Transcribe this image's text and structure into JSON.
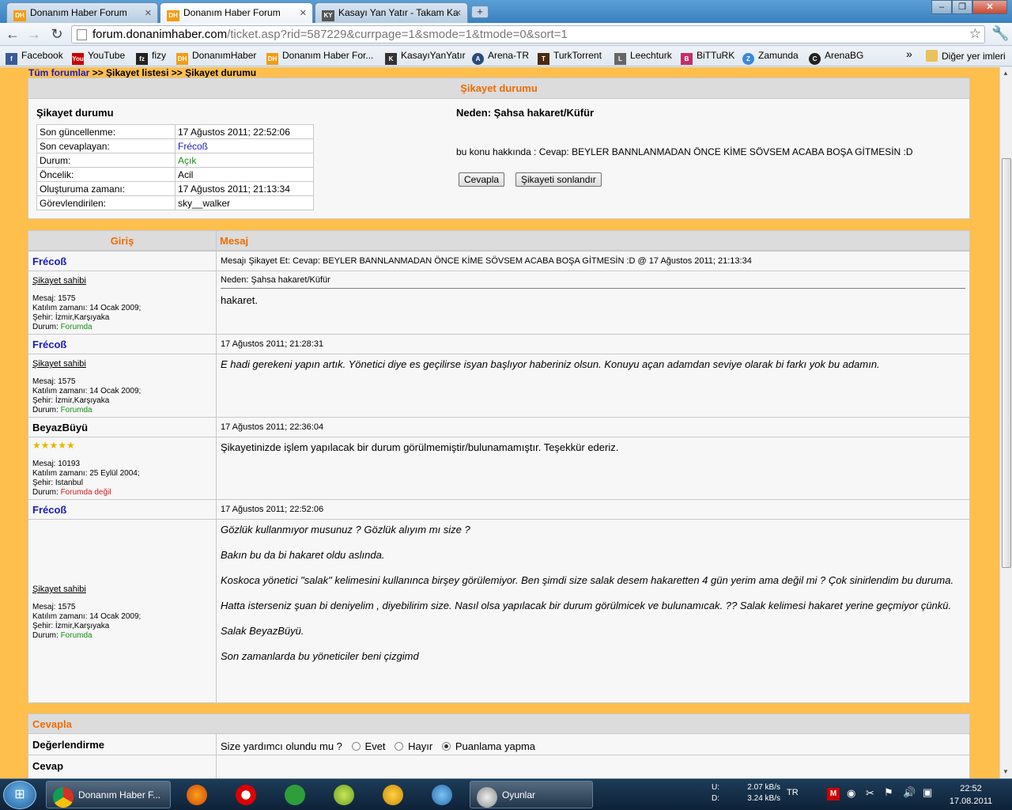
{
  "browser": {
    "tabs": [
      {
        "label": "Donanım Haber Forum",
        "icon": "DH",
        "active": false
      },
      {
        "label": "Donanım Haber Forum",
        "icon": "DH",
        "active": true
      },
      {
        "label": "Kasayı Yan Yatır - Takam Ka",
        "icon": "KY",
        "active": false
      }
    ],
    "url_host": "forum.donanimhaber.com",
    "url_path": "/ticket.asp?rid=587229&currpage=1&smode=1&tmode=0&sort=1"
  },
  "bookmarks": [
    {
      "label": "Facebook",
      "icon": "f",
      "color": "#3b5998"
    },
    {
      "label": "YouTube",
      "icon": "You",
      "color": "#cc0000"
    },
    {
      "label": "fizy",
      "icon": "fz",
      "color": "#222222"
    },
    {
      "label": "DonanımHaber",
      "icon": "DH",
      "color": "#f39c12"
    },
    {
      "label": "Donanım Haber For...",
      "icon": "DH",
      "color": "#f39c12"
    },
    {
      "label": "KasayıYanYatır",
      "icon": "K",
      "color": "#333333"
    },
    {
      "label": "Arena-TR",
      "icon": "A",
      "color": "#2a4a7a"
    },
    {
      "label": "TurkTorrent",
      "icon": "T",
      "color": "#4a2a10"
    },
    {
      "label": "Leechturk",
      "icon": "L",
      "color": "#666666"
    },
    {
      "label": "BiTTuRK",
      "icon": "B",
      "color": "#c0306a"
    },
    {
      "label": "Zamunda",
      "icon": "Z",
      "color": "#3a8ad8"
    },
    {
      "label": "ArenaBG",
      "icon": "C",
      "color": "#222222"
    }
  ],
  "bookmarks_other": "Diğer yer imleri",
  "breadcrumb": {
    "home": "Tüm forumlar",
    "list": ">> Şikayet listesi",
    "current": ">> Şikayet durumu"
  },
  "status_box": {
    "header": "Şikayet durumu",
    "title": "Şikayet durumu",
    "rows": [
      {
        "k": "Son güncellenme:",
        "v": "17 Ağustos 2011; 22:52:06"
      },
      {
        "k": "Son cevaplayan:",
        "v": "Frécoß"
      },
      {
        "k": "Durum:",
        "v": "Açık"
      },
      {
        "k": "Öncelik:",
        "v": "Acil"
      },
      {
        "k": "Oluşturuma zamanı:",
        "v": "17 Ağustos 2011; 21:13:34"
      },
      {
        "k": "Görevlendirilen:",
        "v": "sky__walker"
      }
    ],
    "reason": "Neden: Şahsa hakaret/Küfür",
    "about": "bu konu hakkında : Cevap: BEYLER BANNLANMADAN ÖNCE KİME SÖVSEM ACABA BOŞA GİTMESİN :D",
    "reply_button": "Cevapla",
    "close_button": "Şikayeti sonlandır"
  },
  "messages_table": {
    "col_user": "Giriş",
    "col_msg": "Mesaj",
    "posts": [
      {
        "user": "Frécoß",
        "time": "Mesajı Şikayet Et: Cevap: BEYLER BANNLANMADAN ÖNCE KİME SÖVSEM ACABA BOŞA GİTMESİN :D @ 17 Ağustos 2011; 21:13:34",
        "tag": "Şikayet sahibi",
        "stats": [
          "Mesaj: 1575",
          "Katılım zamanı: 14 Ocak 2009;",
          "Şehir: İzmir,Karşıyaka"
        ],
        "status_label": "Durum:",
        "status": "Forumda",
        "sub": "Neden: Şahsa hakaret/Küfür",
        "body": "hakaret."
      },
      {
        "user": "Frécoß",
        "time": "17 Ağustos 2011; 21:28:31",
        "tag": "Şikayet sahibi",
        "stats": [
          "Mesaj: 1575",
          "Katılım zamanı: 14 Ocak 2009;",
          "Şehir: İzmir,Karşıyaka"
        ],
        "status_label": "Durum:",
        "status": "Forumda",
        "body": "E hadi gerekeni yapın artık. Yönetici diye es geçilirse isyan başlıyor haberiniz olsun. Konuyu açan adamdan seviye olarak bi farkı yok bu adamın."
      },
      {
        "user": "BeyazBüyü",
        "time": "17 Ağustos 2011; 22:36:04",
        "rating_stars": 5,
        "stats": [
          "Mesaj: 10193",
          "Katılım zamanı: 25 Eylül 2004;",
          "Şehir: Istanbul"
        ],
        "status_label": "Durum:",
        "status": "Forumda değil",
        "body": "Şikayetinizde işlem yapılacak bir durum görülmemiştir/bulunamamıştır. Teşekkür ederiz."
      },
      {
        "user": "Frécoß",
        "time": "17 Ağustos 2011; 22:52:06",
        "tag": "Şikayet sahibi",
        "stats": [
          "Mesaj: 1575",
          "Katılım zamanı: 14 Ocak 2009;",
          "Şehir: İzmir,Karşıyaka"
        ],
        "status_label": "Durum:",
        "status": "Forumda",
        "paragraphs": [
          "Gözlük kullanmıyor musunuz ? Gözlük alıyım mı size ?",
          "Bakın bu da bi hakaret oldu aslında.",
          "Koskoca yönetici \"salak\" kelimesini kullanınca birşey görülemiyor. Ben şimdi size salak desem hakaretten 4 gün yerim ama değil mi ? Çok sinirlendim bu duruma.",
          "Hatta isterseniz şuan bi deniyelim , diyebilirim size. Nasıl olsa yapılacak bir durum görülmicek ve bulunamıcak. ?? Salak kelimesi hakaret yerine geçmiyor çünkü.",
          "Salak BeyazBüyü.",
          "Son zamanlarda bu yöneticiler beni çizgimd"
        ]
      }
    ]
  },
  "reply_box": {
    "header": "Cevapla",
    "rating_label": "Değerlendirme",
    "question": "Size yardımcı olundu mu ?",
    "options": [
      {
        "label": "Evet",
        "checked": false
      },
      {
        "label": "Hayır",
        "checked": false
      },
      {
        "label": "Puanlama yapma",
        "checked": true
      }
    ],
    "answer_label": "Cevap"
  },
  "taskbar": {
    "active_window": "Donanım Haber F...",
    "group_label": "Oyunlar",
    "net_up_label": "U:",
    "net_down_label": "D:",
    "net_up": "2.07 kB/s",
    "net_down": "3.24 kB/s",
    "lang": "TR",
    "time": "22:52",
    "date": "17.08.2011"
  }
}
